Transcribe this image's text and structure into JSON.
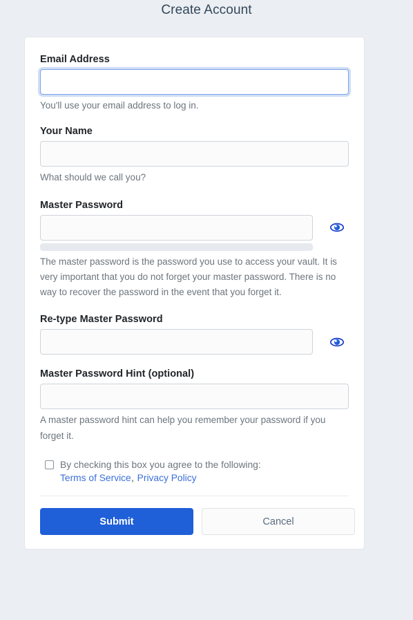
{
  "page": {
    "title": "Create Account"
  },
  "form": {
    "email": {
      "label": "Email Address",
      "value": "",
      "help": "You'll use your email address to log in."
    },
    "name": {
      "label": "Your Name",
      "value": "",
      "help": "What should we call you?"
    },
    "master_password": {
      "label": "Master Password",
      "value": "",
      "help": "The master password is the password you use to access your vault. It is very important that you do not forget your master password. There is no way to recover the password in the event that you forget it.",
      "toggle_icon": "eye-icon",
      "strength_percent": 0
    },
    "retype_password": {
      "label": "Re-type Master Password",
      "value": "",
      "toggle_icon": "eye-icon"
    },
    "hint": {
      "label": "Master Password Hint (optional)",
      "value": "",
      "help": "A master password hint can help you remember your password if you forget it."
    },
    "terms": {
      "checkbox_checked": false,
      "text": "By checking this box you agree to the following:",
      "terms_link": "Terms of Service",
      "separator": ",",
      "privacy_link": "Privacy Policy"
    }
  },
  "actions": {
    "submit_label": "Submit",
    "cancel_label": "Cancel"
  },
  "colors": {
    "accent": "#1f5fd8",
    "link": "#3a6fd8",
    "page_background": "#ebeef2",
    "card_background": "#ffffff",
    "focus_ring": "#7da2e8",
    "help_text": "#6c757d"
  }
}
